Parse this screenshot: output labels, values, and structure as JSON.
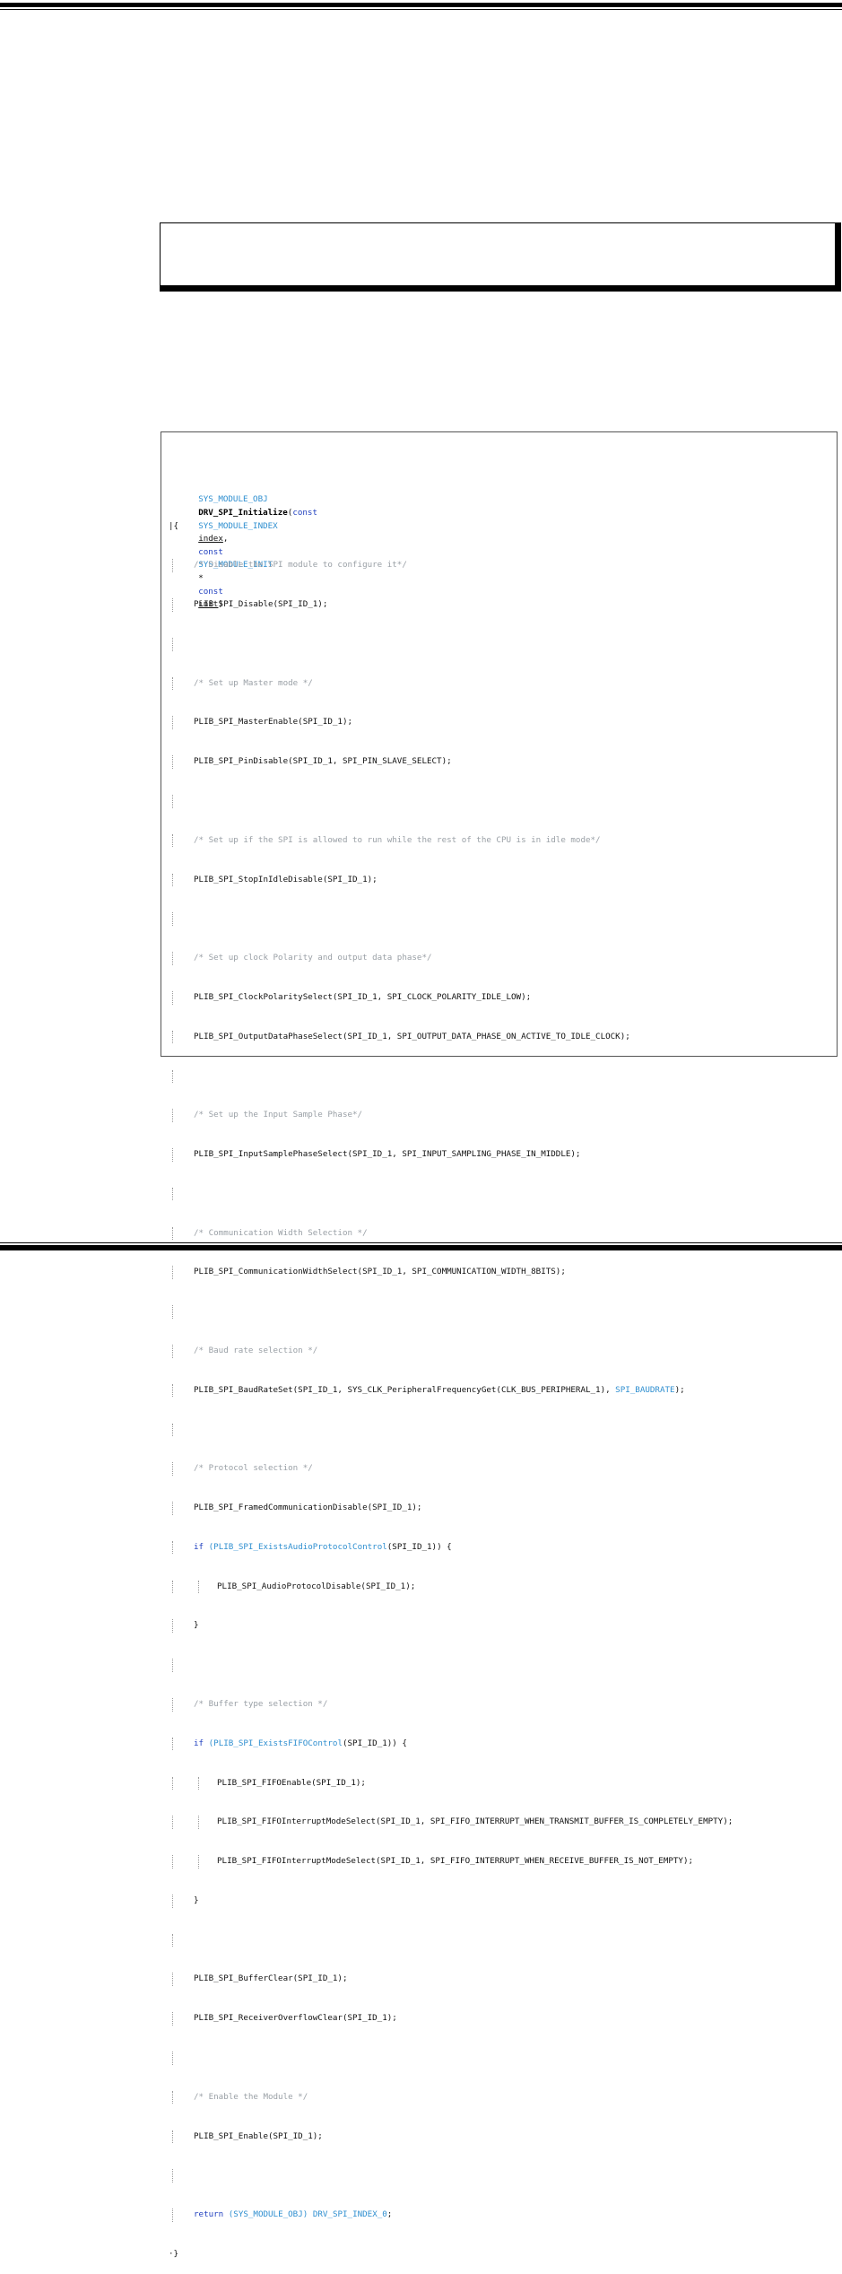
{
  "code": {
    "signature": {
      "ret_type": "SYS_MODULE_OBJ",
      "fn_name": "DRV_SPI_Initialize",
      "open_paren": "(",
      "kw_const1": "const",
      "param1_type": "SYS_MODULE_INDEX",
      "param1_name": "index",
      "comma": ",",
      "kw_const2": "const",
      "param2_type": "SYS_MODULE_INIT",
      "star": "*",
      "kw_const3": "const",
      "param2_name": "init",
      "close_paren": ")"
    },
    "open_brace": "{",
    "close_brace": "}",
    "lines": {
      "c1": "/* Disable the SPI module to configure it*/",
      "l1": "PLIB_SPI_Disable(SPI_ID_1);",
      "c2": "/* Set up Master mode */",
      "l2": "PLIB_SPI_MasterEnable(SPI_ID_1);",
      "l3": "PLIB_SPI_PinDisable(SPI_ID_1, SPI_PIN_SLAVE_SELECT);",
      "c3": "/* Set up if the SPI is allowed to run while the rest of the CPU is in idle mode*/",
      "l4": "PLIB_SPI_StopInIdleDisable(SPI_ID_1);",
      "c4": "/* Set up clock Polarity and output data phase*/",
      "l5": "PLIB_SPI_ClockPolaritySelect(SPI_ID_1, SPI_CLOCK_POLARITY_IDLE_LOW);",
      "l6": "PLIB_SPI_OutputDataPhaseSelect(SPI_ID_1, SPI_OUTPUT_DATA_PHASE_ON_ACTIVE_TO_IDLE_CLOCK);",
      "c5": "/* Set up the Input Sample Phase*/",
      "l7": "PLIB_SPI_InputSamplePhaseSelect(SPI_ID_1, SPI_INPUT_SAMPLING_PHASE_IN_MIDDLE);",
      "c6": "/* Communication Width Selection */",
      "l8": "PLIB_SPI_CommunicationWidthSelect(SPI_ID_1, SPI_COMMUNICATION_WIDTH_8BITS);",
      "c7": "/* Baud rate selection */",
      "l9a": "PLIB_SPI_BaudRateSet(SPI_ID_1, SYS_CLK_PeripheralFrequencyGet(CLK_BUS_PERIPHERAL_1), ",
      "l9b": "SPI_BAUDRATE",
      "l9c": ");",
      "c8": "/* Protocol selection */",
      "l10": "PLIB_SPI_FramedCommunicationDisable(SPI_ID_1);",
      "if1_kw": "if",
      "if1_open": " (",
      "if1_fn": "PLIB_SPI_ExistsAudioProtocolControl",
      "if1_rest": "(SPI_ID_1)) {",
      "l11": "PLIB_SPI_AudioProtocolDisable(SPI_ID_1);",
      "rb1": "}",
      "c9": "/* Buffer type selection */",
      "if2_kw": "if",
      "if2_open": " (",
      "if2_fn": "PLIB_SPI_ExistsFIFOControl",
      "if2_rest": "(SPI_ID_1)) {",
      "l12": "PLIB_SPI_FIFOEnable(SPI_ID_1);",
      "l13": "PLIB_SPI_FIFOInterruptModeSelect(SPI_ID_1, SPI_FIFO_INTERRUPT_WHEN_TRANSMIT_BUFFER_IS_COMPLETELY_EMPTY);",
      "l14": "PLIB_SPI_FIFOInterruptModeSelect(SPI_ID_1, SPI_FIFO_INTERRUPT_WHEN_RECEIVE_BUFFER_IS_NOT_EMPTY);",
      "rb2": "}",
      "l15": "PLIB_SPI_BufferClear(SPI_ID_1);",
      "l16": "PLIB_SPI_ReceiverOverflowClear(SPI_ID_1);",
      "c10": "/* Enable the Module */",
      "l17": "PLIB_SPI_Enable(SPI_ID_1);",
      "ret_kw": "return",
      "ret_cast": "(SYS_MODULE_OBJ)",
      "ret_val": "DRV_SPI_INDEX_0",
      "ret_end": ";"
    }
  },
  "colors": {
    "keyword": "#1f3fbf",
    "type": "#2f8fd0",
    "comment": "#9aa0a6"
  }
}
